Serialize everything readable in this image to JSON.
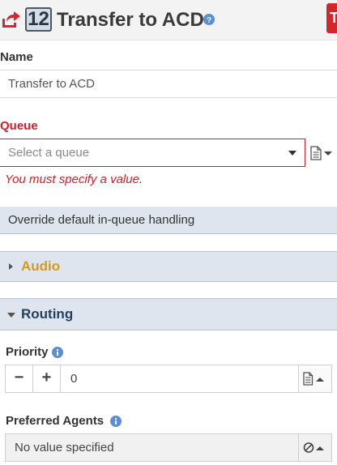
{
  "header": {
    "step_number": "12",
    "title": "Transfer to ACD",
    "icon": "transfer-arrow-icon",
    "help_icon": "question-circle-icon",
    "accent_color": "#d5262b"
  },
  "name_field": {
    "label": "Name",
    "value": "Transfer to ACD"
  },
  "queue_field": {
    "label": "Queue",
    "placeholder": "Select a queue",
    "error": "You must specify a value.",
    "error_color": "#d0212b"
  },
  "override": {
    "label": "Override default in-queue handling"
  },
  "sections": {
    "audio": {
      "title": "Audio",
      "expanded": false,
      "color": "#d69a1a"
    },
    "routing": {
      "title": "Routing",
      "expanded": true,
      "color": "#27405e"
    }
  },
  "priority": {
    "label": "Priority",
    "value": "0",
    "decrement_symbol": "−",
    "increment_symbol": "+"
  },
  "preferred_agents": {
    "label": "Preferred Agents",
    "value": "No value specified"
  }
}
